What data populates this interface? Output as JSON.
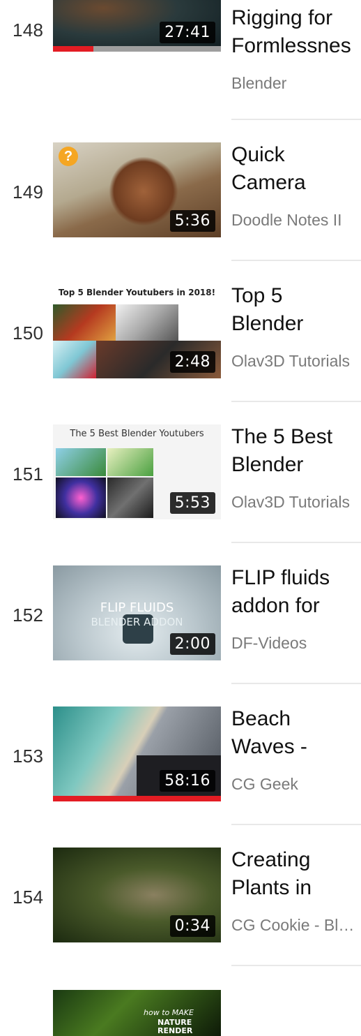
{
  "items": [
    {
      "index": "148",
      "duration": "27:41",
      "title": "Rigging for\nFormlessnes",
      "channel": "Blender",
      "watched_fraction": 0.24,
      "thumb_caption": ""
    },
    {
      "index": "149",
      "duration": "5:36",
      "title": "Quick\nCamera",
      "channel": "Doodle Notes II",
      "badge": "?",
      "thumb_caption": ""
    },
    {
      "index": "150",
      "duration": "2:48",
      "title": "Top 5\nBlender",
      "channel": "Olav3D Tutorials",
      "thumb_caption": "Top 5 Blender Youtubers in 2018!"
    },
    {
      "index": "151",
      "duration": "5:53",
      "title": "The 5 Best\nBlender",
      "channel": "Olav3D Tutorials",
      "thumb_caption": "The 5 Best Blender Youtubers"
    },
    {
      "index": "152",
      "duration": "2:00",
      "title": "FLIP fluids\naddon for",
      "channel": "DF-Videos",
      "thumb_caption": "FLIP FLUIDS",
      "thumb_caption2": "BLENDER ADDON"
    },
    {
      "index": "153",
      "duration": "58:16",
      "title": "Beach\nWaves -",
      "channel": "CG Geek",
      "watched_fraction": 1.0,
      "thumb_caption": ""
    },
    {
      "index": "154",
      "duration": "0:34",
      "title": "Creating\nPlants in",
      "channel": "CG Cookie - Blender",
      "thumb_caption": ""
    },
    {
      "index": "",
      "duration": "",
      "title": "",
      "channel": "",
      "thumb_caption": "how to MAKE",
      "thumb_caption2": "NATURE",
      "thumb_caption3": "RENDER"
    }
  ]
}
